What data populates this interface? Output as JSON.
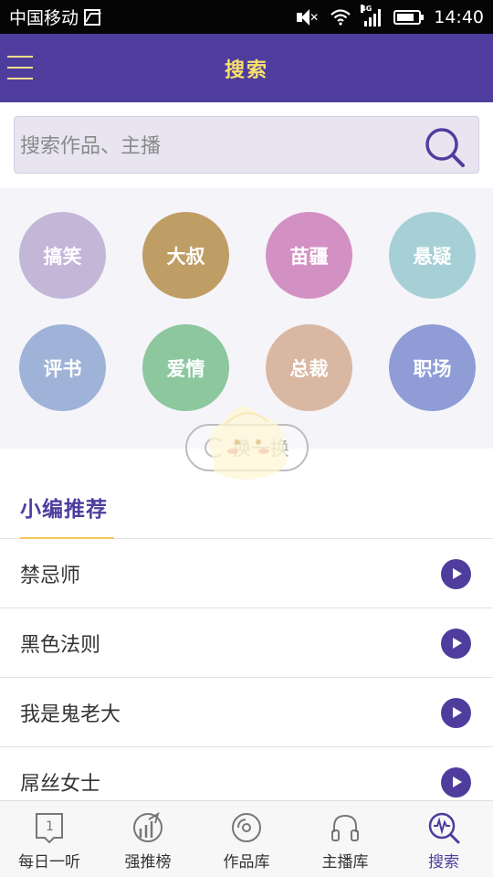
{
  "status_bar": {
    "carrier": "中国移动",
    "network": "4G",
    "time": "14:40"
  },
  "header": {
    "title": "搜索"
  },
  "search": {
    "placeholder": "搜索作品、主播"
  },
  "categories": [
    {
      "label": "搞笑",
      "color": "#c3b7d8"
    },
    {
      "label": "大叔",
      "color": "#bf9e66"
    },
    {
      "label": "苗疆",
      "color": "#d391c3"
    },
    {
      "label": "悬疑",
      "color": "#a6d0d6"
    },
    {
      "label": "评书",
      "color": "#9fb3d8"
    },
    {
      "label": "爱情",
      "color": "#8cc79e"
    },
    {
      "label": "总裁",
      "color": "#d8b8a2"
    },
    {
      "label": "职场",
      "color": "#8f9cd6"
    }
  ],
  "refresh_label": "换一换",
  "editor_picks": {
    "title": "小编推荐",
    "items": [
      "禁忌师",
      "黑色法则",
      "我是鬼老大",
      "屌丝女士"
    ]
  },
  "bottom_nav": [
    {
      "label": "每日一听",
      "icon": "book-icon"
    },
    {
      "label": "强推榜",
      "icon": "chart-icon"
    },
    {
      "label": "作品库",
      "icon": "disc-icon"
    },
    {
      "label": "主播库",
      "icon": "headphone-icon"
    },
    {
      "label": "搜索",
      "icon": "search-wave-icon"
    }
  ],
  "accent_color": "#4f3d9e"
}
